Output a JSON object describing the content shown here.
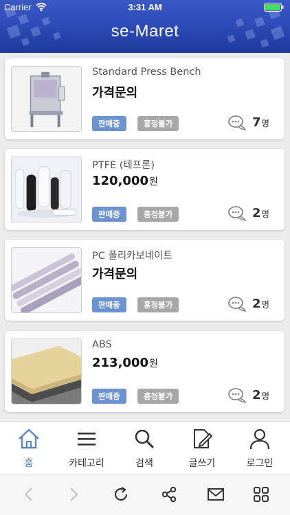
{
  "status_bar": {
    "carrier": "Carrier",
    "time": "3:31 AM"
  },
  "app": {
    "title": "se-Maret"
  },
  "products": [
    {
      "name": "Standard Press Bench",
      "price": "가격문의",
      "price_unit": "",
      "status": "판매중",
      "negotiation": "흥정불가",
      "comment_count": "7",
      "count_unit": "명",
      "image": "press-bench-photo"
    },
    {
      "name": "PTFE (테프론)",
      "price": "120,000",
      "price_unit": "원",
      "status": "판매중",
      "negotiation": "흥정불가",
      "comment_count": "2",
      "count_unit": "명",
      "image": "ptfe-rods-photo"
    },
    {
      "name": "PC 폴리카보네이트",
      "price": "가격문의",
      "price_unit": "",
      "status": "판매중",
      "negotiation": "흥정불가",
      "comment_count": "2",
      "count_unit": "명",
      "image": "pc-rods-photo"
    },
    {
      "name": "ABS",
      "price": "213,000",
      "price_unit": "원",
      "status": "판매중",
      "negotiation": "흥정불가",
      "comment_count": "2",
      "count_unit": "명",
      "image": "abs-sheets-photo"
    }
  ],
  "tabs": [
    {
      "label": "홈",
      "icon": "home-icon",
      "active": true
    },
    {
      "label": "카테고리",
      "icon": "menu-icon",
      "active": false
    },
    {
      "label": "검색",
      "icon": "search-icon",
      "active": false
    },
    {
      "label": "글쓰기",
      "icon": "write-icon",
      "active": false
    },
    {
      "label": "로그인",
      "icon": "user-icon",
      "active": false
    }
  ],
  "toolbar": [
    "back-icon",
    "forward-icon",
    "refresh-icon",
    "share-icon",
    "mail-icon",
    "grid-icon"
  ],
  "colors": {
    "header": "#2f4cb8",
    "badge_sale": "#6a93cf",
    "badge_nego": "#a7a7a7",
    "tab_active": "#5b86c6"
  }
}
